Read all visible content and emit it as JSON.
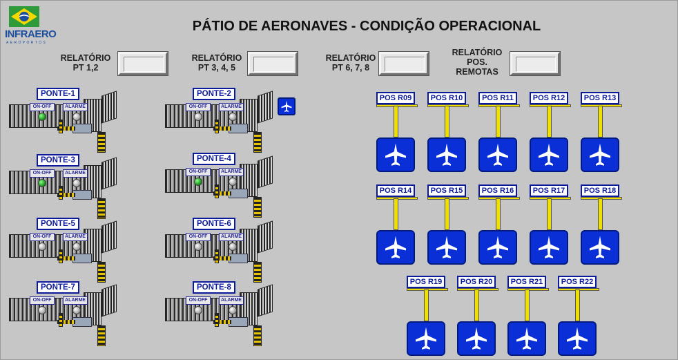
{
  "header": {
    "logo_text": "INFRAERO",
    "logo_sub": "AEROPORTOS",
    "title": "PÁTIO DE AERONAVES - CONDIÇÃO OPERACIONAL"
  },
  "reports": [
    {
      "label_l1": "RELATÓRIO",
      "label_l2": "PT 1,2"
    },
    {
      "label_l1": "RELATÓRIO",
      "label_l2": "PT 3, 4, 5"
    },
    {
      "label_l1": "RELATÓRIO",
      "label_l2": "PT 6, 7, 8"
    },
    {
      "label_l1": "RELATÓRIO",
      "label_l2": "POS.",
      "label_l3": "REMOTAS"
    }
  ],
  "bridges": [
    {
      "name": "PONTE-1",
      "on_off": "ON-OFF",
      "alarm": "ALARME",
      "status": "on"
    },
    {
      "name": "PONTE-2",
      "on_off": "ON-OFF",
      "alarm": "ALARME",
      "status": "off"
    },
    {
      "name": "PONTE-3",
      "on_off": "ON-OFF",
      "alarm": "ALARME",
      "status": "on"
    },
    {
      "name": "PONTE-4",
      "on_off": "ON-OFF",
      "alarm": "ALARME",
      "status": "on"
    },
    {
      "name": "PONTE-5",
      "on_off": "ON-OFF",
      "alarm": "ALARME",
      "status": "off"
    },
    {
      "name": "PONTE-6",
      "on_off": "ON-OFF",
      "alarm": "ALARME",
      "status": "off"
    },
    {
      "name": "PONTE-7",
      "on_off": "ON-OFF",
      "alarm": "ALARME",
      "status": "off"
    },
    {
      "name": "PONTE-8",
      "on_off": "ON-OFF",
      "alarm": "ALARME",
      "status": "off"
    }
  ],
  "remote_positions": {
    "row1": [
      "POS R09",
      "POS R10",
      "POS R11",
      "POS R12",
      "POS R13"
    ],
    "row2": [
      "POS R14",
      "POS R15",
      "POS R16",
      "POS R17",
      "POS R18"
    ],
    "row3": [
      "POS R19",
      "POS R20",
      "POS R21",
      "POS R22"
    ]
  },
  "colors": {
    "background": "#c6c6c6",
    "label_blue": "#0b1a9a",
    "plane_blue": "#0a2fd6",
    "led_on": "#1d9a1d",
    "led_off": "#a9a9a9",
    "stem_yellow": "#f0e000"
  },
  "icons": {
    "plane": "airplane-icon",
    "logo": "infraero-logo"
  }
}
